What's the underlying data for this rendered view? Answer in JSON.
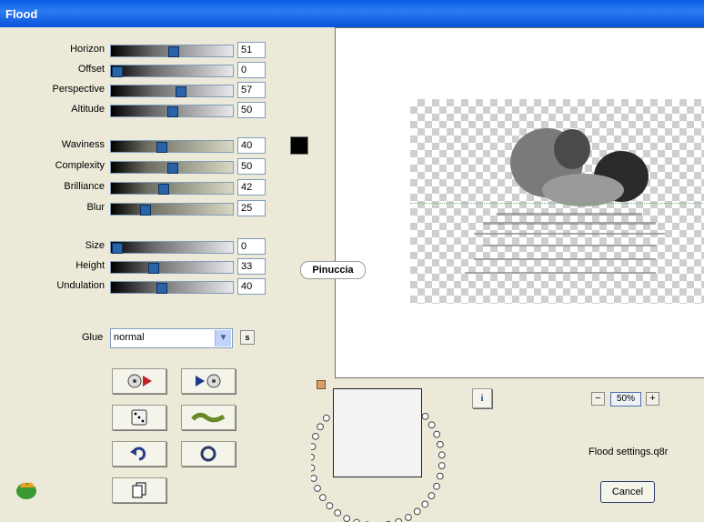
{
  "window": {
    "title": "Flood"
  },
  "colors": {
    "titlebar": "#0a5fe6",
    "swatch": "#000000",
    "panel": "#ece9d8"
  },
  "sliders_group1": [
    {
      "label": "Horizon",
      "value": "51",
      "fraction": 0.51
    },
    {
      "label": "Offset",
      "value": "0",
      "fraction": 0.0
    },
    {
      "label": "Perspective",
      "value": "57",
      "fraction": 0.57
    },
    {
      "label": "Altitude",
      "value": "50",
      "fraction": 0.5
    }
  ],
  "sliders_group2": [
    {
      "label": "Waviness",
      "value": "40",
      "fraction": 0.4
    },
    {
      "label": "Complexity",
      "value": "50",
      "fraction": 0.5
    },
    {
      "label": "Brilliance",
      "value": "42",
      "fraction": 0.42
    },
    {
      "label": "Blur",
      "value": "25",
      "fraction": 0.25
    }
  ],
  "sliders_group3": [
    {
      "label": "Size",
      "value": "0",
      "fraction": 0.0
    },
    {
      "label": "Height",
      "value": "33",
      "fraction": 0.33
    },
    {
      "label": "Undulation",
      "value": "40",
      "fraction": 0.4
    }
  ],
  "glue": {
    "label": "Glue",
    "value": "normal",
    "s_label": "s"
  },
  "preview": {
    "watermark": "Pinuccia"
  },
  "zoom": {
    "value": "50%",
    "minus": "−",
    "plus": "+"
  },
  "info_label": "i",
  "settings_file": "Flood settings.q8r",
  "cancel_label": "Cancel",
  "icons": [
    "play-reverse-icon",
    "play-forward-icon",
    "dice-icon",
    "wave-icon",
    "undo-icon",
    "reset-icon",
    "copy-icon",
    "ring-preview-icon",
    "app-logo-icon"
  ]
}
